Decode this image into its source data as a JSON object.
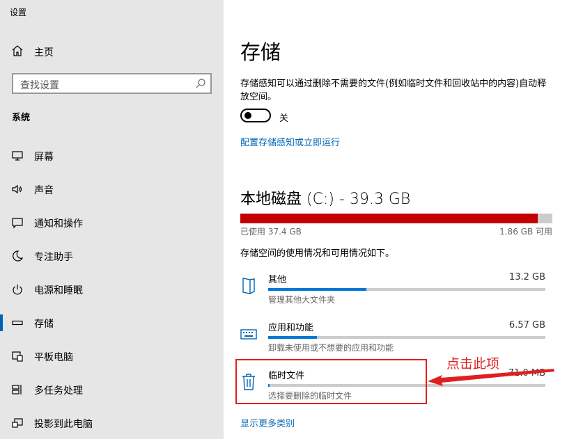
{
  "window": {
    "title": "设置"
  },
  "sidebar": {
    "home_label": "主页",
    "search_placeholder": "查找设置",
    "section_title": "系统",
    "items": [
      {
        "label": "屏幕",
        "icon": "monitor-icon"
      },
      {
        "label": "声音",
        "icon": "speaker-icon"
      },
      {
        "label": "通知和操作",
        "icon": "notification-icon"
      },
      {
        "label": "专注助手",
        "icon": "moon-icon"
      },
      {
        "label": "电源和睡眠",
        "icon": "power-icon"
      },
      {
        "label": "存储",
        "icon": "storage-icon",
        "selected": true
      },
      {
        "label": "平板电脑",
        "icon": "tablet-icon"
      },
      {
        "label": "多任务处理",
        "icon": "multitask-icon"
      },
      {
        "label": "投影到此电脑",
        "icon": "project-icon"
      }
    ]
  },
  "main": {
    "title": "存储",
    "sense_description": "存储感知可以通过删除不需要的文件(例如临时文件和回收站中的内容)自动释放空间。",
    "toggle_state_label": "关",
    "toggle_on": false,
    "configure_link": "配置存储感知或立即运行",
    "disk_title": "本地磁盘 (C:) - 39.3 GB",
    "disk_used_label": "已使用 37.4 GB",
    "disk_free_label": "1.86 GB 可用",
    "disk_used_fraction": 0.953,
    "usage_description": "存储空间的使用情况和可用情况如下。",
    "categories": [
      {
        "name": "其他",
        "size": "13.2 GB",
        "sub": "管理其他大文件夹",
        "fraction": 0.355,
        "icon": "folder-icon"
      },
      {
        "name": "应用和功能",
        "size": "6.57 GB",
        "sub": "卸载未使用或不想要的应用和功能",
        "fraction": 0.177,
        "icon": "keyboard-icon"
      },
      {
        "name": "临时文件",
        "size": "71.0 MB",
        "sub": "选择要删除的临时文件",
        "fraction": 0.004,
        "icon": "trash-icon"
      }
    ],
    "more_link": "显示更多类别"
  },
  "annotation": {
    "text": "点击此项",
    "color": "#e02020"
  },
  "colors": {
    "accent": "#0078d7",
    "disk_fill": "#c40000",
    "link": "#0066b4",
    "sidebar_bg": "#e6e6e6"
  }
}
